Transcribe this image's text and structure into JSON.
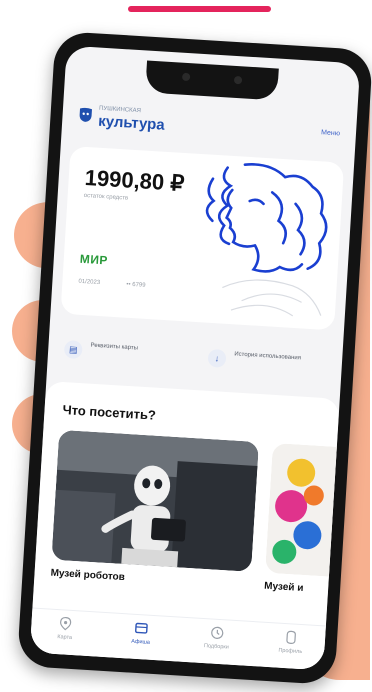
{
  "app": {
    "brand_small": "ПУШКИНСКАЯ",
    "brand_big": "культура",
    "menu_link": "Меню"
  },
  "card": {
    "balance": "1990,80 ₽",
    "balance_note": "остаток средств",
    "payment_system": "МИР",
    "expiry": "01/2023",
    "number_masked": "•• 6799"
  },
  "actions": [
    {
      "label": "Реквизиты карты",
      "icon": "card-icon"
    },
    {
      "label": "История использования",
      "icon": "history-icon"
    }
  ],
  "section": {
    "title": "Что посетить?",
    "tiles": [
      {
        "caption": "Музей роботов"
      },
      {
        "caption": "Музей и"
      }
    ]
  },
  "tabbar": [
    {
      "label": "Карта",
      "icon": "map-pin-icon",
      "active": false
    },
    {
      "label": "Афиша",
      "icon": "ticket-icon",
      "active": true
    },
    {
      "label": "Подборки",
      "icon": "collection-icon",
      "active": false
    },
    {
      "label": "Профиль",
      "icon": "profile-icon",
      "active": false
    }
  ],
  "colors": {
    "accent_bar": "#e4245c",
    "brand_blue": "#1f4fae",
    "mir_green": "#2a9a3b",
    "hand": "#f7b08f"
  }
}
